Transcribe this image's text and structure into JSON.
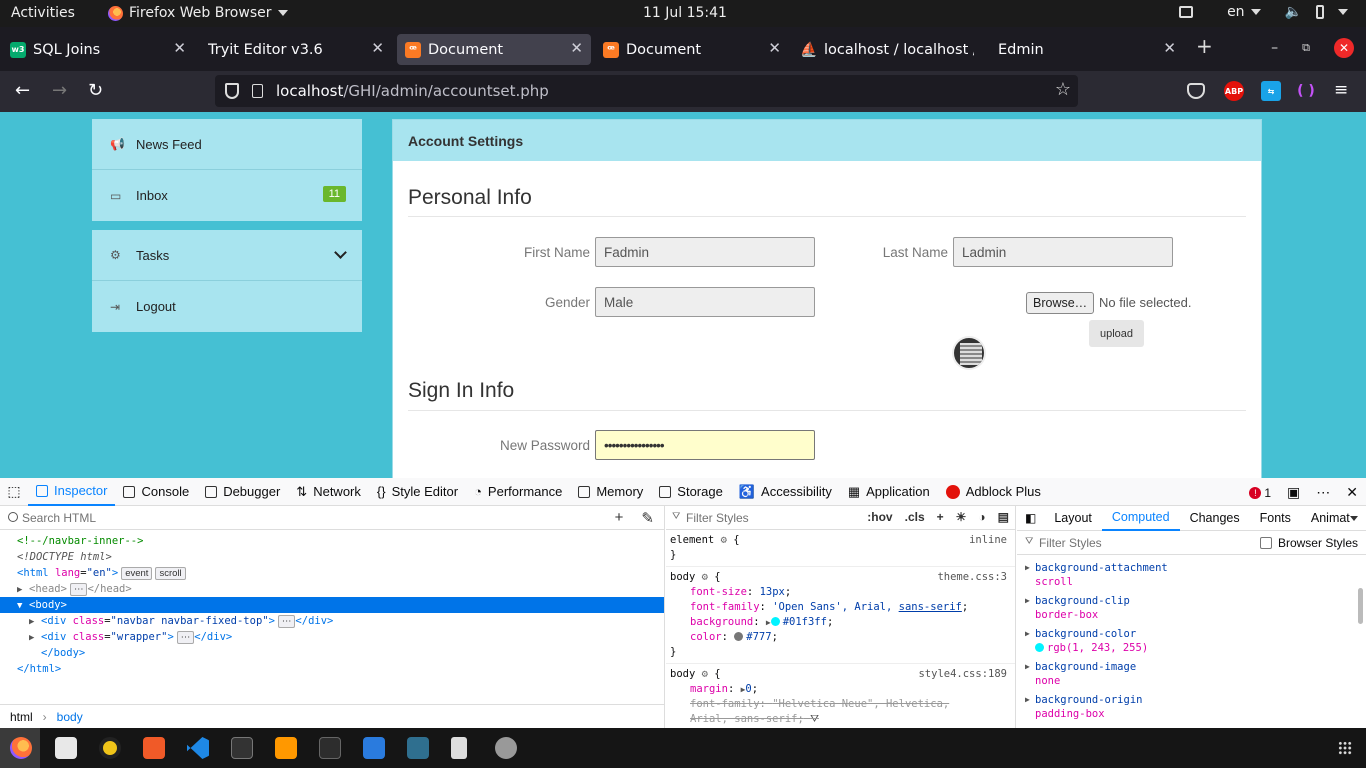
{
  "system_bar": {
    "activities": "Activities",
    "app_name": "Firefox Web Browser",
    "clock": "11 Jul  15:41",
    "language": "en"
  },
  "browser": {
    "tabs": [
      {
        "label": "SQL Joins",
        "icon": "w3-icon",
        "icon_color": "#04aa6d"
      },
      {
        "label": "Tryit Editor v3.6",
        "icon": "none"
      },
      {
        "label": "Document",
        "icon": "xampp-icon",
        "icon_color": "#fb7a24",
        "active": true
      },
      {
        "label": "Document",
        "icon": "xampp-icon",
        "icon_color": "#fb7a24"
      },
      {
        "label": "localhost / localhost /",
        "icon": "phpmyadmin-icon"
      },
      {
        "label": "Edmin",
        "icon": "none"
      }
    ],
    "url_host": "localhost",
    "url_path": "/GHI/admin/accountset.php",
    "extensions": [
      "pocket-icon",
      "adblock-plus-icon",
      "translate-icon",
      "extension-icon"
    ],
    "adblock_label": "ABP"
  },
  "webpage": {
    "sidebar": {
      "group1": [
        {
          "label": "News Feed",
          "icon": "bullhorn-icon"
        },
        {
          "label": "Inbox",
          "icon": "inbox-icon",
          "badge": "11"
        }
      ],
      "group2": [
        {
          "label": "Tasks",
          "icon": "cog-icon"
        },
        {
          "label": "Logout",
          "icon": "sign-out-icon"
        }
      ]
    },
    "panel_title": "Account Settings",
    "personal_info_title": "Personal Info",
    "first_name_label": "First Name",
    "first_name_value": "Fadmin",
    "last_name_label": "Last Name",
    "last_name_value": "Ladmin",
    "gender_label": "Gender",
    "gender_value": "Male",
    "browse_label": "Browse…",
    "no_file_text": "No file selected.",
    "upload_label": "upload",
    "signin_info_title": "Sign In Info",
    "new_password_label": "New Password",
    "new_password_value": "••••••••••••••••"
  },
  "devtools": {
    "tabs": [
      "Inspector",
      "Console",
      "Debugger",
      "Network",
      "Style Editor",
      "Performance",
      "Memory",
      "Storage",
      "Accessibility",
      "Application",
      "Adblock Plus"
    ],
    "error_count": "1",
    "search_placeholder": "Search HTML",
    "markup": {
      "line1": "<!--/navbar-inner-->",
      "line2": "<!DOCTYPE html>",
      "html_tag": "html",
      "lang_attr": "lang",
      "lang_val": "\"en\"",
      "event_pill": "event",
      "scroll_pill": "scroll",
      "head_line": "<head>",
      "head_close": "</head>",
      "body_line": "<body>",
      "div1_class": "\"navbar navbar-fixed-top\"",
      "div2_class": "\"wrapper\"",
      "body_close": "</body>",
      "html_close": "</html>"
    },
    "breadcrumbs": [
      "html",
      "body"
    ],
    "rules_filter": "Filter Styles",
    "rules_tools": [
      ":hov",
      ".cls"
    ],
    "rules": {
      "element_selector": "element",
      "element_source": "inline",
      "body_selector": "body",
      "theme_source": "theme.css:3",
      "font_size": "13px",
      "font_family_a": "'Open Sans', Arial,",
      "font_family_b": "sans-serif",
      "background": "#01f3ff",
      "color": "#777",
      "style4_source": "style4.css:189",
      "margin": "0",
      "font_family_strike": "\"Helvetica Neue\", Helvetica,",
      "font_family_strike2": "Arial, sans-serif;"
    },
    "side_tabs": [
      "Layout",
      "Computed",
      "Changes",
      "Fonts",
      "Animat"
    ],
    "computed_filter": "Filter Styles",
    "browser_styles": "Browser Styles",
    "computed": [
      {
        "name": "background-attachment",
        "value": "scroll"
      },
      {
        "name": "background-clip",
        "value": "border-box"
      },
      {
        "name": "background-color",
        "value": "rgb(1, 243, 255)"
      },
      {
        "name": "background-image",
        "value": "none"
      },
      {
        "name": "background-origin",
        "value": "padding-box"
      }
    ]
  },
  "colors": {
    "page_bg_value": "#01f3ff",
    "accent": "#0a84ff",
    "badge": "#6ab72c"
  }
}
